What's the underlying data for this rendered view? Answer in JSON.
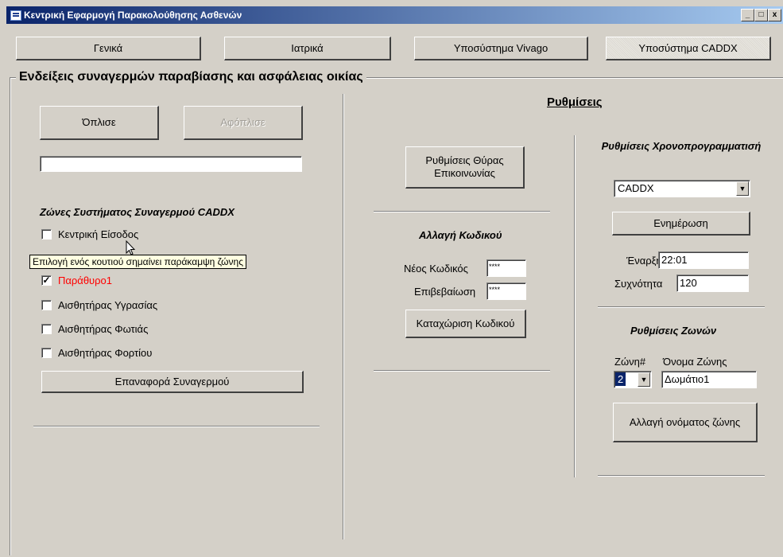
{
  "window": {
    "title": "Κεντρική Εφαρμογή Παρακολούθησης Ασθενών",
    "minimize": "_",
    "maximize": "□",
    "close": "x"
  },
  "tabs": [
    {
      "label": "Γενικά"
    },
    {
      "label": "Ιατρικά"
    },
    {
      "label": "Υποσύστημα Vivago"
    },
    {
      "label": "Υποσύστημα CADDX"
    }
  ],
  "group_title": "Ενδείξεις συναγερμών παραβίασης και ασφάλειας οικίας",
  "left": {
    "arm_button": "Όπλισε",
    "disarm_button": "Αφόπλισε",
    "status_value": "",
    "zones_title": "Ζώνες Συστήματος Συναγερμού CADDX",
    "zones": [
      {
        "label": "Κεντρική Είσοδος",
        "checked": false,
        "color": "#000000"
      },
      {
        "label": "Παράθυρο1",
        "checked": true,
        "color": "#ff0000"
      },
      {
        "label": "Αισθητήρας Υγρασίας",
        "checked": false,
        "color": "#000000"
      },
      {
        "label": "Αισθητήρας Φωτιάς",
        "checked": false,
        "color": "#000000"
      },
      {
        "label": "Αισθητήρας Φορτίου",
        "checked": false,
        "color": "#000000"
      }
    ],
    "tooltip": "Επιλογή ενός κουτιού σημαίνει παράκαμψη ζώνης",
    "reset_button": "Επαναφορά Συναγερμού"
  },
  "settings": {
    "heading": "Ρυθμίσεις",
    "port_button": "Ρυθμίσεις Θύρας Επικοινωνίας",
    "code_title": "Αλλαγή Κωδικού",
    "new_code_label": "Νέος Κωδικός",
    "new_code_value": "****",
    "confirm_label": "Επιβεβαίωση",
    "confirm_value": "****",
    "save_code_button": "Καταχώριση Κωδικού"
  },
  "schedule": {
    "title": "Ρυθμίσεις Χρονοπρογραμματισή",
    "system_select": "CADDX",
    "update_button": "Ενημέρωση",
    "start_label": "Έναρξη",
    "start_value": "22:01",
    "freq_label": "Συχνότητα",
    "freq_value": "120"
  },
  "zone_settings": {
    "title": "Ρυθμίσεις Ζωνών",
    "zone_no_label": "Ζώνη#",
    "zone_name_label": "Όνομα Ζώνης",
    "zone_no_value": "2",
    "zone_name_value": "Δωμάτιο1",
    "rename_button": "Αλλαγή ονόματος ζώνης"
  },
  "colors": {
    "title_bar_start": "#0a246a",
    "title_bar_end": "#a6caf0",
    "window_bg": "#d4d0c8",
    "tooltip_bg": "#ffffe1",
    "alarm_text": "#ff0000",
    "selected_zone_bg": "#0a246a"
  }
}
